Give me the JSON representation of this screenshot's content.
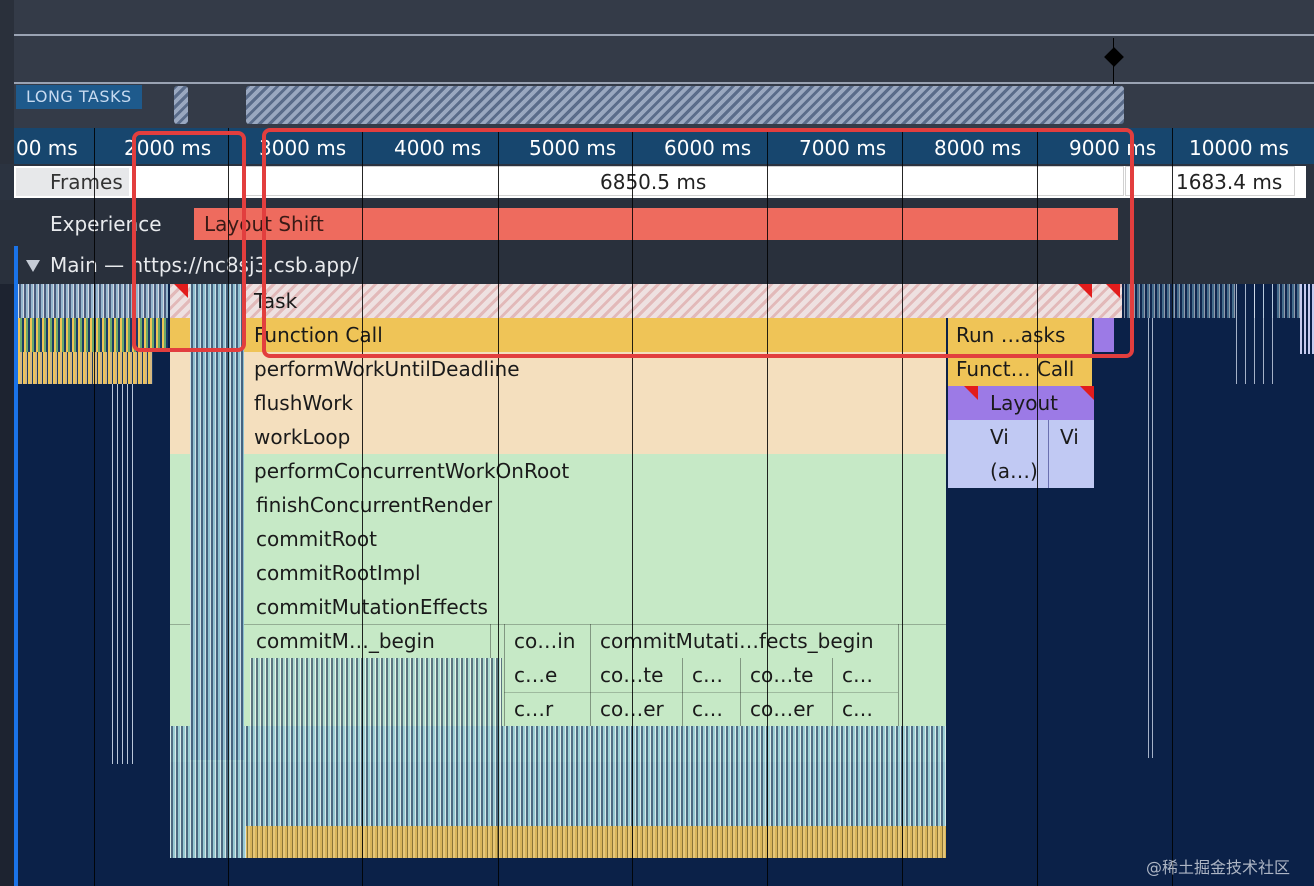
{
  "overview": {
    "long_tasks_label": "LONG TASKS"
  },
  "ruler": {
    "ticks": [
      "00 ms",
      "2000 ms",
      "3000 ms",
      "4000 ms",
      "5000 ms",
      "6000 ms",
      "7000 ms",
      "8000 ms",
      "9000 ms",
      "10000 ms"
    ]
  },
  "tracks": {
    "frames_label": "Frames",
    "frame_long_label": "6850.5 ms",
    "frame_right_label": "1683.4 ms",
    "experience_label": "Experience",
    "layout_shift_label": "Layout Shift",
    "main_label": "Main — https://nc8sj3.csb.app/"
  },
  "flame": {
    "task": "Task",
    "function_call": "Function Call",
    "run_tasks": "Run …asks",
    "perform_work": "performWorkUntilDeadline",
    "funct_call": "Funct… Call",
    "flush_work": "flushWork",
    "layout": "Layout",
    "work_loop": "workLoop",
    "vi_1": "Vi",
    "vi_2": "Vi",
    "perform_concurrent": "performConcurrentWorkOnRoot",
    "anon": "(a…)",
    "finish_concurrent": "finishConcurrentRender",
    "commit_root": "commitRoot",
    "commit_root_impl": "commitRootImpl",
    "commit_mutation_effects": "commitMutationEffects",
    "commit_m_begin": "commitM…_begin",
    "co_in": "co…in",
    "commit_mutati_begin": "commitMutati…fects_begin",
    "r1": [
      "c…e",
      "co…te",
      "c…",
      "co…te",
      "c…"
    ],
    "r2": [
      "c…r",
      "co…er",
      "c…",
      "co…er",
      "c…"
    ]
  },
  "watermark": "@稀土掘金技术社区",
  "colors": {
    "background": "#0b2148",
    "ruler_band": "#17466e",
    "layout_shift": "#ee6b5e",
    "function_call": "#efc457",
    "script_light": "#f4dfbe",
    "react_green": "#c6e9c6",
    "layout_purple": "#9c7ae6",
    "light_purple": "#c1c9f3",
    "highlight_red": "#e23e3e"
  }
}
